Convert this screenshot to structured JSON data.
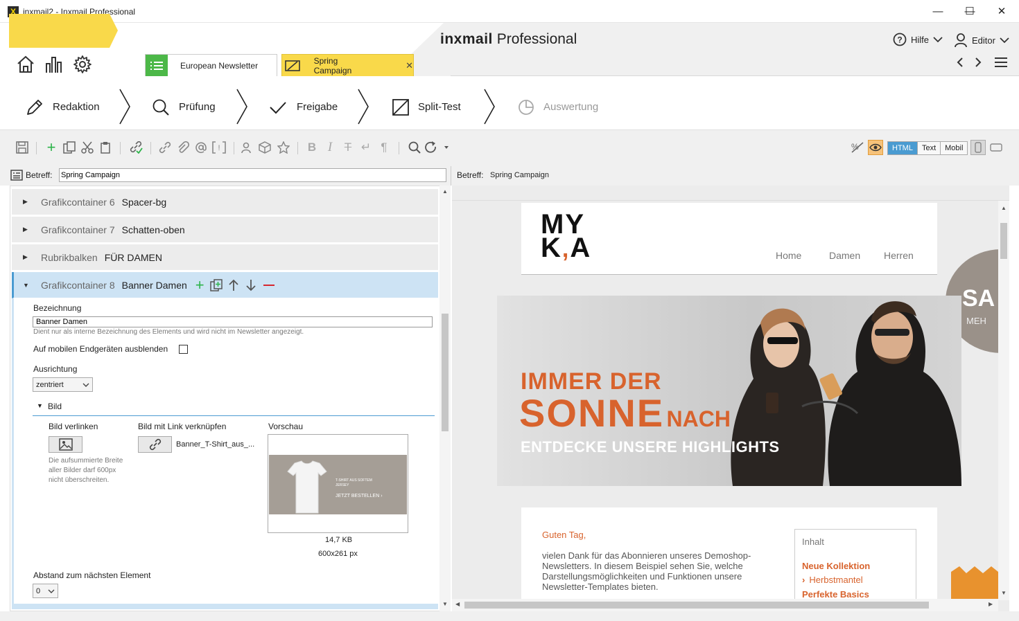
{
  "window": {
    "title": "inxmail2 - Inxmail Professional",
    "minimize": "—",
    "maximize": "☐",
    "close": "✕"
  },
  "header": {
    "logo_bold": "inxmail",
    "logo_light": "Professional",
    "help_label": "Hilfe",
    "role_label": "Editor"
  },
  "tabs": [
    {
      "label": "European Newsletter",
      "active": false
    },
    {
      "label": "Spring Campaign",
      "active": true,
      "close": "✕"
    }
  ],
  "workflow": {
    "steps": [
      {
        "label": "Redaktion",
        "state": "active"
      },
      {
        "label": "Prüfung",
        "state": "normal"
      },
      {
        "label": "Freigabe",
        "state": "normal"
      },
      {
        "label": "Split-Test",
        "state": "normal"
      },
      {
        "label": "Auswertung",
        "state": "disabled"
      }
    ]
  },
  "toolbar": {
    "view_modes": [
      "HTML",
      "Text",
      "Mobil"
    ],
    "active_view": "HTML"
  },
  "subject": {
    "label": "Betreff:",
    "value": "Spring Campaign",
    "preview_label": "Betreff:",
    "preview_value": "Spring Campaign"
  },
  "elements": [
    {
      "type": "Grafikcontainer 6",
      "name": "Spacer-bg",
      "open": false
    },
    {
      "type": "Grafikcontainer 7",
      "name": "Schatten-oben",
      "open": false
    },
    {
      "type": "Rubrikbalken",
      "name": "FÜR DAMEN",
      "open": false
    },
    {
      "type": "Grafikcontainer 8",
      "name": "Banner Damen",
      "open": true
    }
  ],
  "properties": {
    "bezeichnung_label": "Bezeichnung",
    "bezeichnung_value": "Banner Damen",
    "bezeichnung_hint": "Dient nur als interne Bezeichnung des Elements und wird nicht im Newsletter angezeigt.",
    "mobile_hide_label": "Auf mobilen Endgeräten ausblenden",
    "ausrichtung_label": "Ausrichtung",
    "ausrichtung_value": "zentriert",
    "bild_section": "Bild",
    "bild_verlinken_label": "Bild verlinken",
    "bild_verlinken_hint": "Die aufsummierte Breite aller Bilder darf 600px nicht überschreiten.",
    "bild_link_label": "Bild mit Link verknüpfen",
    "bild_link_value": "Banner_T-Shirt_aus_...",
    "vorschau_label": "Vorschau",
    "vorschau_size": "14,7 KB",
    "vorschau_dims": "600x261 px",
    "vorschau_tshirt_text": "T-SHIRT AUS SOFTEM JERSEY",
    "vorschau_cta": "JETZT BESTELLEN  ›",
    "abstand_label": "Abstand zum nächsten Element",
    "abstand_value": "0"
  },
  "newsletter": {
    "brand_line1": "MY",
    "brand_line2_a": "K",
    "brand_line2_b": "A",
    "nav": [
      "Home",
      "Damen",
      "Herren"
    ],
    "badge_text": "SA",
    "badge_sub": "MEH",
    "banner_line1": "IMMER DER",
    "banner_line2": "SONNE",
    "banner_line2b": "NACH",
    "banner_line3": "ENTDECKE UNSERE HIGHLIGHTS",
    "greeting": "Guten Tag,",
    "body_text": "vielen Dank für das Abonnieren unseres Demoshop-Newsletters. In diesem Beispiel sehen Sie, welche Darstellungsmöglichkeiten und Funktionen unsere Newsletter-Templates bieten.",
    "toc_title": "Inhalt",
    "toc_items": [
      "Neue Kollektion",
      "Herbstmantel",
      "Perfekte Basics"
    ]
  },
  "colors": {
    "accent_yellow": "#f9d94a",
    "orange": "#d8632d",
    "selection_blue": "#cde3f4",
    "green": "#2db34a",
    "red": "#d6262d"
  }
}
